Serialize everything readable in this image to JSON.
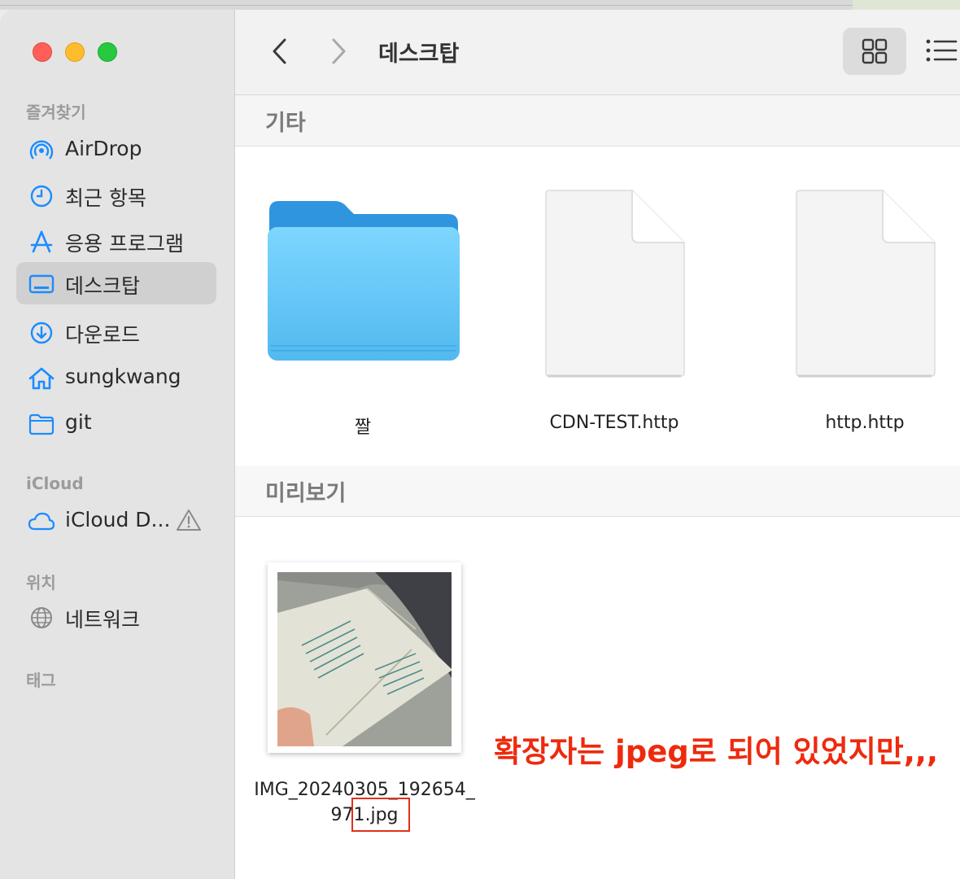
{
  "sidebar": {
    "sections": {
      "favorites": "즐겨찾기",
      "icloud": "iCloud",
      "locations": "위치",
      "tags": "태그"
    },
    "items": [
      {
        "label": "AirDrop",
        "icon": "airdrop-icon"
      },
      {
        "label": "최근 항목",
        "icon": "clock-icon"
      },
      {
        "label": "응용 프로그램",
        "icon": "applications-icon"
      },
      {
        "label": "데스크탑",
        "icon": "desktop-icon",
        "selected": true
      },
      {
        "label": "다운로드",
        "icon": "download-icon"
      },
      {
        "label": "sungkwang",
        "icon": "home-icon"
      },
      {
        "label": "git",
        "icon": "folder-icon"
      },
      {
        "label": "iCloud D...",
        "icon": "cloud-icon",
        "warning_icon": "warning-icon"
      },
      {
        "label": "네트워크",
        "icon": "network-icon"
      }
    ]
  },
  "toolbar": {
    "title": "데스크탑",
    "back_icon": "chevron-left-icon",
    "forward_icon": "chevron-right-icon",
    "view_grid_icon": "grid-view-icon",
    "view_list_icon": "list-view-icon"
  },
  "groups": [
    {
      "title": "기타",
      "files": [
        {
          "name": "짤",
          "kind": "folder"
        },
        {
          "name": "CDN-TEST.http",
          "kind": "document"
        },
        {
          "name": "http.http",
          "kind": "document"
        }
      ]
    },
    {
      "title": "미리보기",
      "files": [
        {
          "name_line1": "IMG_20240305_192654_",
          "name_line2": "971.jpg",
          "kind": "image"
        }
      ]
    }
  ],
  "annotation": {
    "text": "확장자는 jpeg로 되어 있었지만,,,",
    "color": "#ee2a0e"
  },
  "colors": {
    "accent": "#1a8cff",
    "folder": "#5cc2f7"
  }
}
